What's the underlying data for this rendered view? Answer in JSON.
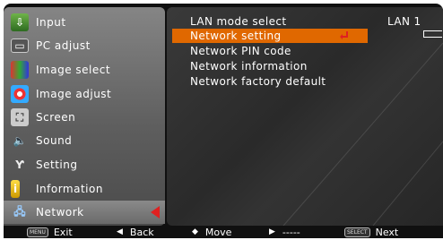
{
  "sidebar": {
    "items": [
      {
        "label": "Input",
        "icon": "input-icon"
      },
      {
        "label": "PC adjust",
        "icon": "pc-adjust-icon"
      },
      {
        "label": "Image select",
        "icon": "image-select-icon"
      },
      {
        "label": "Image adjust",
        "icon": "image-adjust-icon"
      },
      {
        "label": "Screen",
        "icon": "screen-icon"
      },
      {
        "label": "Sound",
        "icon": "sound-icon"
      },
      {
        "label": "Setting",
        "icon": "setting-icon"
      },
      {
        "label": "Information",
        "icon": "information-icon"
      },
      {
        "label": "Network",
        "icon": "network-icon",
        "selected": true
      }
    ]
  },
  "panel": {
    "rows": [
      {
        "label": "LAN mode select",
        "value": "LAN 1"
      },
      {
        "label": "Network setting",
        "selected": true
      },
      {
        "label": "Network PIN code"
      },
      {
        "label": "Network information"
      },
      {
        "label": "Network factory default"
      }
    ]
  },
  "footer": {
    "exit_key": "MENU",
    "exit": "Exit",
    "back": "Back",
    "move": "Move",
    "dashes": "-----",
    "next_key": "SELECT",
    "next": "Next"
  },
  "colors": {
    "accent": "#e06800",
    "arrow": "#e02020"
  }
}
